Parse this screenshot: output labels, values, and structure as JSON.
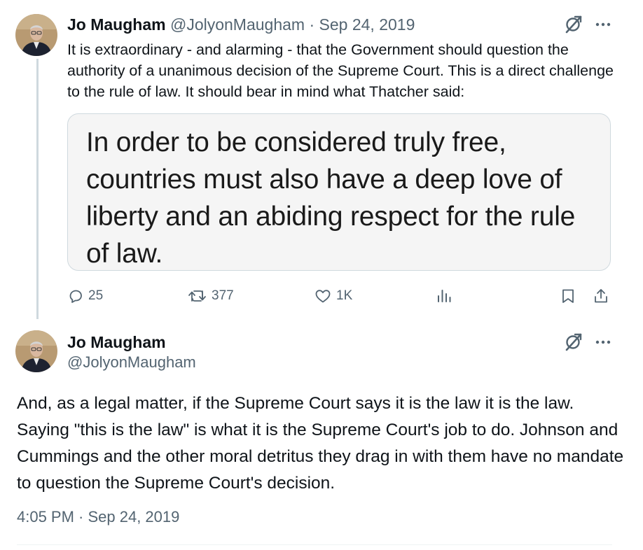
{
  "tweets": [
    {
      "author_name": "Jo Maugham",
      "author_handle": "@JolyonMaugham",
      "separator": "·",
      "date": "Sep 24, 2019",
      "text": "It is extraordinary - and alarming - that the Government should question the authority of a unanimous decision of the Supreme Court. This is a direct challenge to the rule of law. It should bear in mind what Thatcher said:",
      "quote_image_text": "In order to be considered truly free, countries must also have a deep love of liberty and an abiding respect for the rule of law.",
      "replies": "25",
      "retweets": "377",
      "likes": "1K",
      "icons": [
        "grok-icon",
        "more-icon",
        "reply-icon",
        "retweet-icon",
        "like-icon",
        "views-icon",
        "bookmark-icon",
        "share-icon"
      ]
    },
    {
      "author_name": "Jo Maugham",
      "author_handle": "@JolyonMaugham",
      "text": "And, as a legal matter, if the Supreme Court says it is the law it is the law. Saying \"this is the law\" is what it is the Supreme Court's job to do. Johnson and Cummings and the other moral detritus they drag in with them have no mandate to question the Supreme Court's decision.",
      "timestamp": "4:05 PM · Sep 24, 2019",
      "icons": [
        "grok-icon",
        "more-icon"
      ]
    }
  ],
  "colors": {
    "text_primary": "#0f1419",
    "text_secondary": "#536471",
    "thread_line": "#cfd9de",
    "quote_background": "#f5f5f5"
  }
}
